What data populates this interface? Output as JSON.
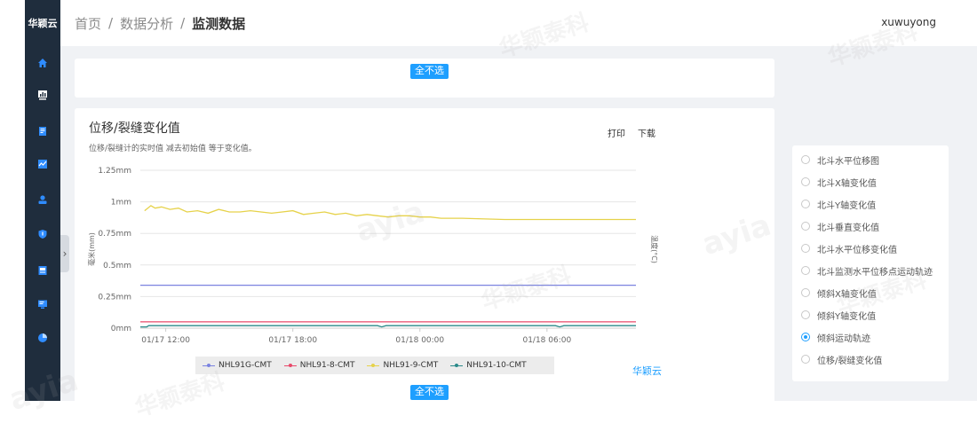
{
  "app": {
    "logo_text": "华颖云",
    "user": "xuwuyong"
  },
  "breadcrumb": {
    "items": [
      "首页",
      "数据分析"
    ],
    "separator": "/",
    "current": "监测数据"
  },
  "sidebar": {
    "icons": [
      "home-icon",
      "dashboard-icon",
      "report-icon",
      "chart-icon",
      "user-icon",
      "shield-icon",
      "document-icon",
      "monitor-icon",
      "pie-chart-icon"
    ]
  },
  "top_panel": {
    "deselect_all": "全不选"
  },
  "chart_panel": {
    "title": "位移/裂缝变化值",
    "subtitle": "位移/裂缝计的实时值 减去初始值 等于变化值。",
    "print": "打印",
    "download": "下载",
    "brand": "华颖云",
    "deselect_all": "全不选"
  },
  "chart_data": {
    "type": "line",
    "title": "位移/裂缝变化值",
    "ylabel": "毫米(mm)",
    "y2label": "温度(°C)",
    "y_ticks": [
      "1.25mm",
      "1mm",
      "0.75mm",
      "0.5mm",
      "0.25mm",
      "0mm"
    ],
    "ylim": [
      0,
      1.25
    ],
    "x_ticks": [
      "01/17 12:00",
      "01/17 18:00",
      "01/18 00:00",
      "01/18 06:00"
    ],
    "x_hours": [
      12,
      18,
      24,
      30
    ],
    "xlim": [
      10.8,
      34.2
    ],
    "grid": true,
    "series": [
      {
        "name": "NHL91G-CMT",
        "color": "#7b83e0",
        "x": [
          10.8,
          34.2
        ],
        "values": [
          0.34,
          0.34
        ]
      },
      {
        "name": "NHL91-8-CMT",
        "color": "#e8496a",
        "x": [
          10.8,
          34.2
        ],
        "values": [
          0.05,
          0.05
        ]
      },
      {
        "name": "NHL91-9-CMT",
        "color": "#e6d24a",
        "x": [
          11.0,
          11.3,
          11.5,
          11.8,
          12.2,
          12.6,
          13.0,
          13.5,
          14.0,
          14.5,
          15.0,
          15.5,
          16.0,
          16.5,
          17.0,
          17.5,
          18.0,
          18.5,
          19.0,
          19.5,
          20.0,
          20.5,
          21.0,
          21.5,
          22.0,
          22.5,
          23.0,
          23.5,
          24.0,
          24.5,
          25.0,
          26.0,
          28.0,
          30.0,
          32.0,
          34.2
        ],
        "values": [
          0.93,
          0.97,
          0.95,
          0.96,
          0.94,
          0.95,
          0.92,
          0.93,
          0.91,
          0.94,
          0.92,
          0.92,
          0.93,
          0.92,
          0.91,
          0.92,
          0.93,
          0.9,
          0.91,
          0.92,
          0.9,
          0.91,
          0.89,
          0.9,
          0.89,
          0.88,
          0.89,
          0.89,
          0.88,
          0.88,
          0.87,
          0.87,
          0.86,
          0.86,
          0.86,
          0.86
        ]
      },
      {
        "name": "NHL91-10-CMT",
        "color": "#2a8a8a",
        "x": [
          10.8,
          11.1,
          11.2,
          22.0,
          22.2,
          22.4,
          30.4,
          30.6,
          30.8,
          34.2
        ],
        "values": [
          0.01,
          0.01,
          0.02,
          0.02,
          0.01,
          0.02,
          0.02,
          0.01,
          0.02,
          0.02
        ]
      }
    ]
  },
  "options": {
    "items": [
      "北斗水平位移图",
      "北斗X轴变化值",
      "北斗Y轴变化值",
      "北斗垂直变化值",
      "北斗水平位移变化值",
      "北斗监测水平位移点运动轨迹",
      "倾斜X轴变化值",
      "倾斜Y轴变化值",
      "倾斜运动轨迹",
      "位移/裂缝变化值"
    ],
    "selected_index": 8
  },
  "watermark": {
    "latin": "ayia",
    "cjk": "华颖泰科"
  }
}
